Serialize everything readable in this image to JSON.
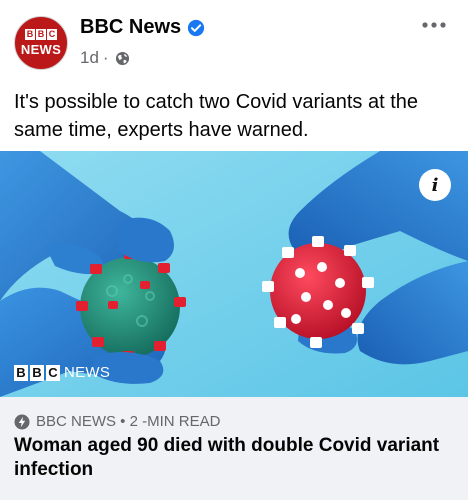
{
  "post": {
    "page_name": "BBC News",
    "time": "1d",
    "separator": "·",
    "visibility_icon": "globe-icon",
    "verified_icon": "verified-badge-icon",
    "more_icon": "more-options-icon",
    "text": "It's possible to catch two Covid variants at the same time, experts have warned."
  },
  "avatar": {
    "letters": [
      "B",
      "B",
      "C"
    ],
    "word": "NEWS",
    "color": "#bb1919"
  },
  "image": {
    "watermark_letters": [
      "B",
      "B",
      "C"
    ],
    "watermark_word": "NEWS",
    "info_label": "i"
  },
  "link_card": {
    "source": "BBC NEWS • 2 -MIN READ",
    "title": "Woman aged 90 died with double Covid variant infection",
    "icon": "instant-article-bolt-icon"
  },
  "colors": {
    "accent": "#1877f2",
    "secondary_text": "#65676b",
    "card_bg": "#f0f2f5",
    "brand": "#bb1919"
  }
}
